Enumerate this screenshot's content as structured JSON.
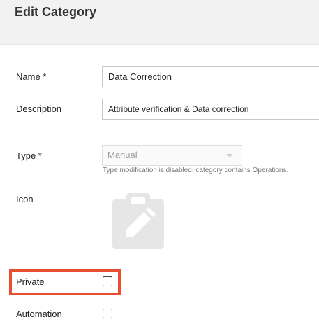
{
  "header": {
    "title": "Edit Category"
  },
  "form": {
    "name_label": "Name *",
    "name_value": "Data Correction",
    "description_label": "Description",
    "description_value": "Attribute verification & Data correction",
    "type_label": "Type *",
    "type_value": "Manual",
    "type_hint": "Type modification is disabled: category contains Operations.",
    "icon_label": "Icon",
    "icon_name": "clipboard-edit-icon",
    "private_label": "Private",
    "private_checked": false,
    "automation_label": "Automation",
    "automation_checked": false
  },
  "colors": {
    "highlight": "#e94e32",
    "header_bg": "#f2f2f2",
    "icon": "#e5e5e5"
  }
}
